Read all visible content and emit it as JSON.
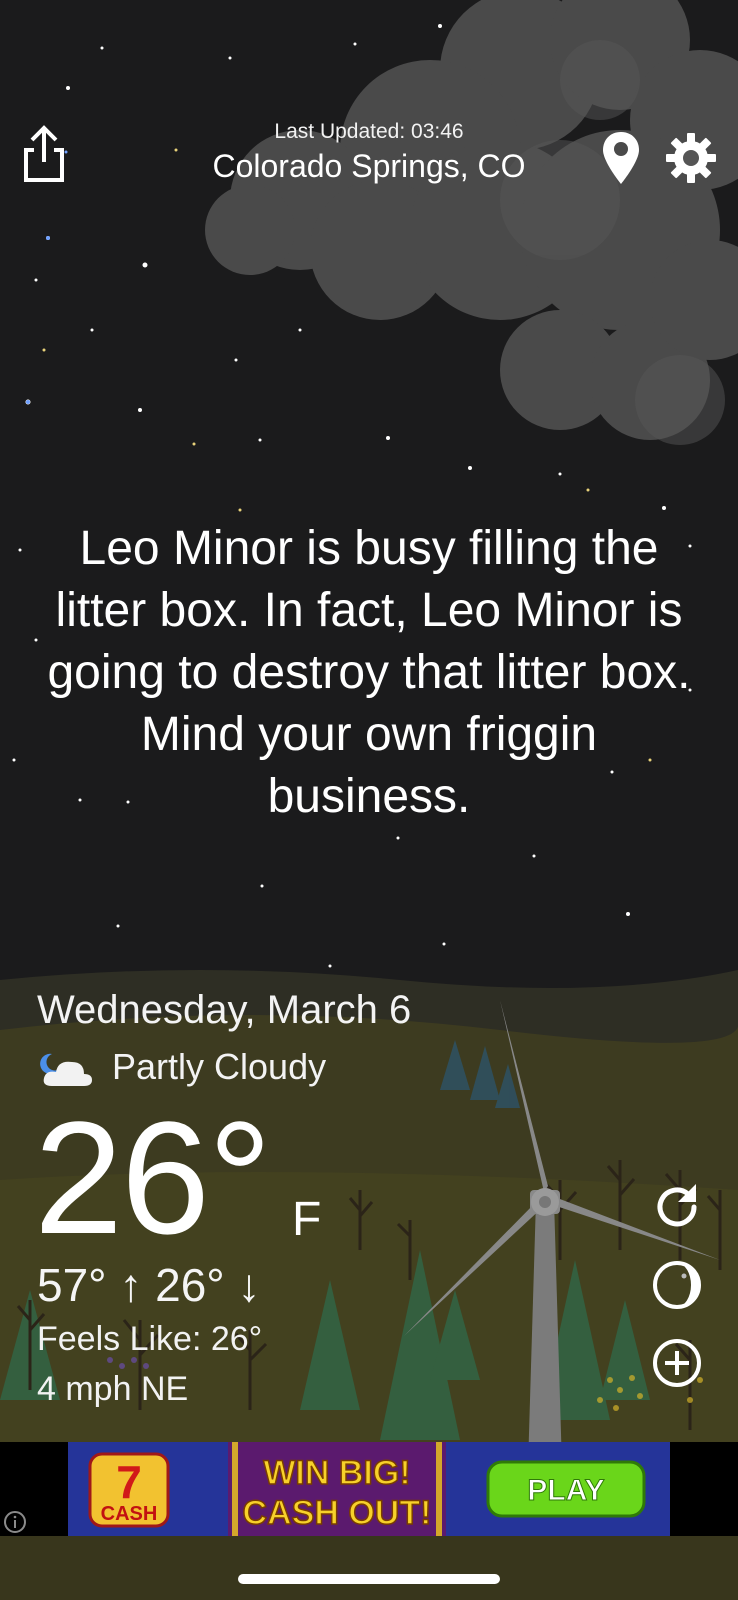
{
  "header": {
    "last_updated": "Last Updated: 03:46",
    "city": "Colorado Springs, CO"
  },
  "forecast_text": "Leo Minor is busy filling the litter box. In fact, Leo Minor is going to destroy that litter box. Mind your own friggin business.",
  "weather": {
    "date": "Wednesday, March 6",
    "condition": "Partly Cloudy",
    "condition_icon": "partly-cloudy-night-icon",
    "temperature": "26°",
    "unit": "F",
    "high_low": "57° ↑ 26° ↓",
    "feels_like": "Feels Like: 26°",
    "wind": "4 mph NE"
  },
  "actions": {
    "refresh_icon": "refresh-icon",
    "moon_icon": "moon-phase-icon",
    "add_icon": "add-location-icon"
  },
  "ad": {
    "brand": "7 CASH",
    "headline_1": "WIN BIG!",
    "headline_2": "CASH OUT!",
    "cta": "PLAY"
  },
  "colors": {
    "sky": "#1b1b1c",
    "hills": "#3f3d22",
    "trees": "#2f5a3a",
    "ad_green": "#6ad61a",
    "ad_yellow": "#f7d12a"
  }
}
